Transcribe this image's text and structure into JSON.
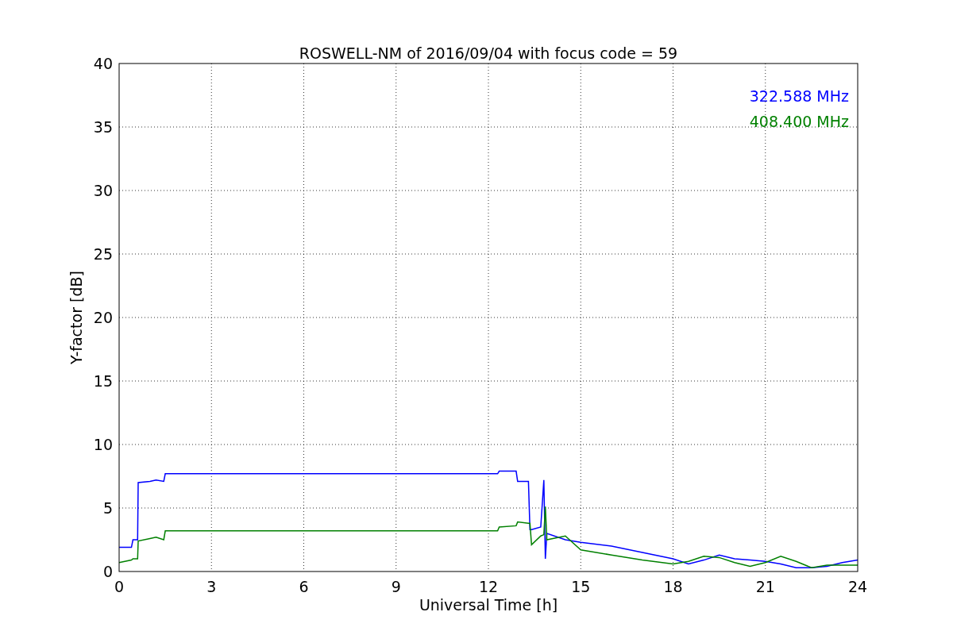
{
  "chart_data": {
    "type": "line",
    "title": "ROSWELL-NM of 2016/09/04 with focus code = 59",
    "xlabel": "Universal Time [h]",
    "ylabel": "Y-factor [dB]",
    "x": [
      0,
      0.4,
      0.45,
      0.6,
      0.62,
      1.0,
      1.2,
      1.45,
      1.5,
      12.3,
      12.35,
      12.9,
      12.95,
      13.3,
      13.35,
      13.4,
      13.7,
      13.8,
      13.85,
      13.9,
      14.5,
      15,
      16,
      17,
      18,
      18.5,
      19,
      19.5,
      20,
      20.5,
      21,
      21.5,
      22,
      22.5,
      23,
      23.5,
      24
    ],
    "series": [
      {
        "name": "322.588 MHz",
        "color": "#0000ff",
        "values": [
          1.9,
          1.9,
          2.5,
          2.5,
          7.0,
          7.1,
          7.2,
          7.1,
          7.7,
          7.7,
          7.9,
          7.9,
          7.1,
          7.1,
          3.3,
          3.3,
          3.5,
          7.2,
          1.0,
          3.0,
          2.5,
          2.3,
          2.0,
          1.5,
          1.0,
          0.6,
          0.9,
          1.3,
          1.0,
          0.9,
          0.8,
          0.6,
          0.3,
          0.3,
          0.4,
          0.7,
          0.9
        ]
      },
      {
        "name": "408.400 MHz",
        "color": "#008000",
        "values": [
          0.7,
          0.9,
          1.0,
          1.0,
          2.4,
          2.6,
          2.7,
          2.5,
          3.2,
          3.2,
          3.5,
          3.6,
          3.9,
          3.8,
          3.8,
          2.1,
          2.8,
          2.9,
          5.1,
          2.5,
          2.8,
          1.7,
          1.3,
          0.9,
          0.6,
          0.8,
          1.2,
          1.1,
          0.7,
          0.4,
          0.7,
          1.2,
          0.8,
          0.3,
          0.5,
          0.5,
          0.5
        ]
      }
    ],
    "xlim": [
      0,
      24
    ],
    "ylim": [
      0,
      40
    ],
    "xticks": [
      0,
      3,
      6,
      9,
      12,
      15,
      18,
      21,
      24
    ],
    "yticks": [
      0,
      5,
      10,
      15,
      20,
      25,
      30,
      35,
      40
    ],
    "grid": true
  }
}
